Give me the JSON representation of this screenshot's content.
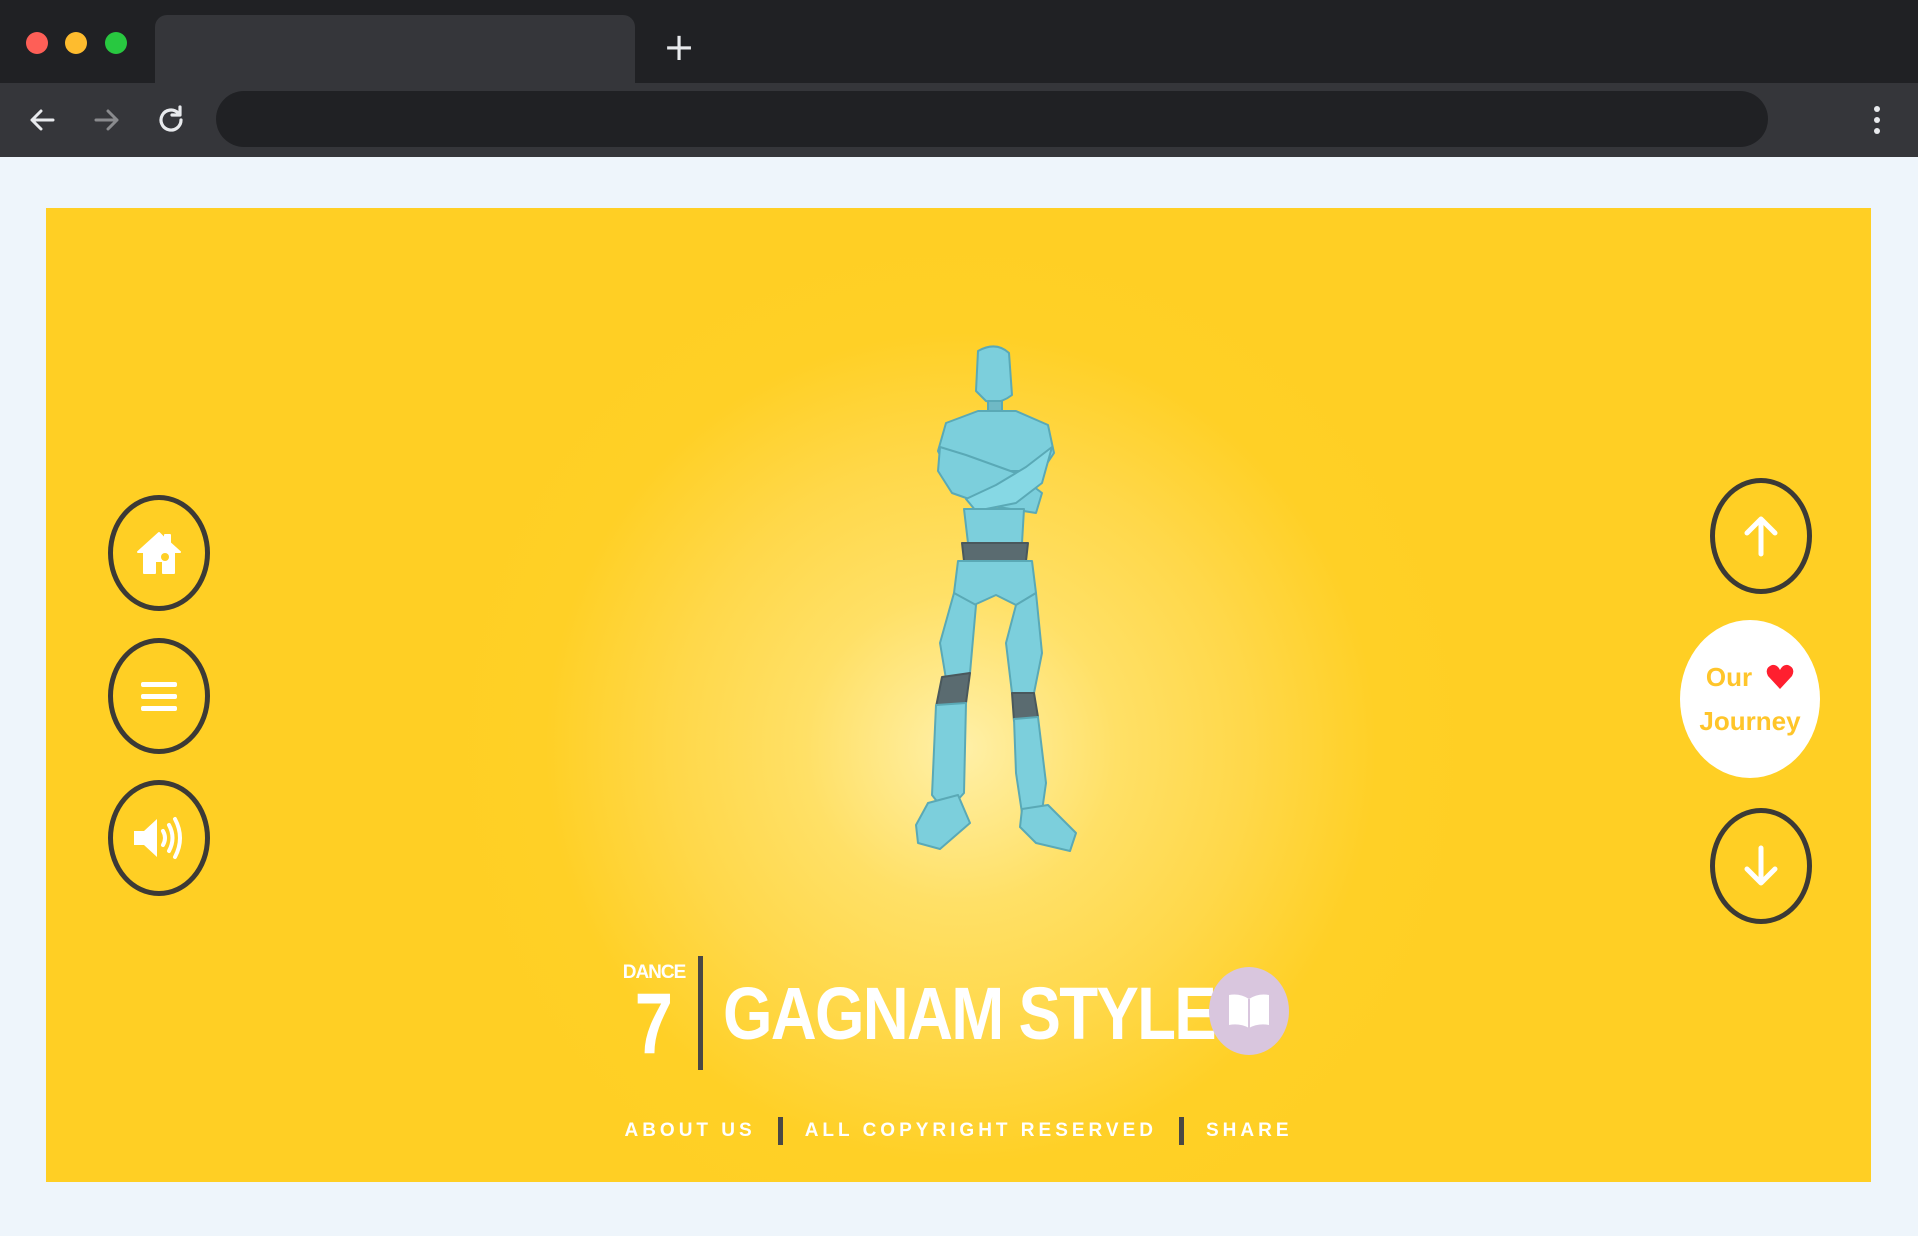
{
  "browser": {
    "new_tab_symbol": "+",
    "icons": [
      "back-arrow-icon",
      "forward-arrow-icon",
      "reload-icon",
      "menu-dots-icon"
    ]
  },
  "colors": {
    "stage_background": "#ffcf24",
    "button_ring": "#3c3a36",
    "title_text": "#ffffff",
    "journey_text": "#ffc52a",
    "heart": "#ff1f2f",
    "book_button": "#d9c6de",
    "figure": "#7ccfdc"
  },
  "left_controls": [
    {
      "name": "home-button",
      "icon": "home-icon"
    },
    {
      "name": "menu-button",
      "icon": "hamburger-icon"
    },
    {
      "name": "sound-button",
      "icon": "speaker-icon"
    }
  ],
  "right_controls": {
    "up_icon": "arrow-up-icon",
    "down_icon": "arrow-down-icon",
    "journey_line1": "Our",
    "journey_line2": "Journey",
    "journey_icon": "heart-icon"
  },
  "dance": {
    "label": "DANCE",
    "number": "7",
    "name": "GAGNAM STYLE",
    "info_icon": "book-icon"
  },
  "footer": {
    "about": "ABOUT US",
    "copyright": "ALL COPYRIGHT RESERVED",
    "share": "SHARE"
  }
}
